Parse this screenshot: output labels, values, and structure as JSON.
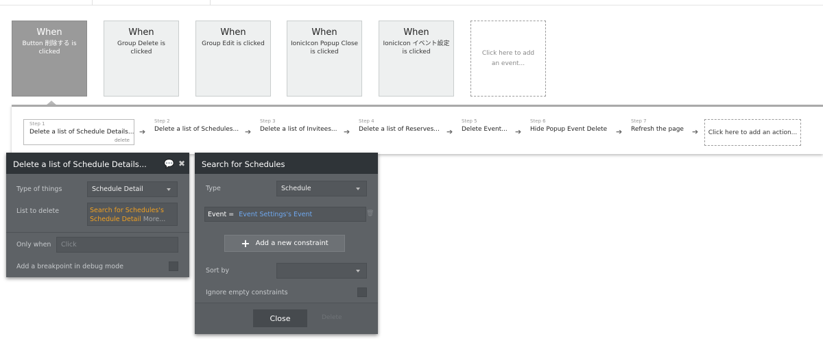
{
  "events": [
    {
      "when": "When",
      "desc": "Button 削除する is clicked"
    },
    {
      "when": "When",
      "desc": "Group Delete is clicked"
    },
    {
      "when": "When",
      "desc": "Group Edit is clicked"
    },
    {
      "when": "When",
      "desc": "IonicIcon Popup Close is clicked"
    },
    {
      "when": "When",
      "desc": "IonicIcon イベント設定 is clicked"
    }
  ],
  "add_event_label": "Click here to add an event...",
  "steps": [
    {
      "num": "Step 1",
      "title": "Delete a list of Schedule Details...",
      "tag": "delete"
    },
    {
      "num": "Step 2",
      "title": "Delete a list of Schedules..."
    },
    {
      "num": "Step 3",
      "title": "Delete a list of Invitees..."
    },
    {
      "num": "Step 4",
      "title": "Delete a list of Reserves..."
    },
    {
      "num": "Step 5",
      "title": "Delete Event..."
    },
    {
      "num": "Step 6",
      "title": "Hide Popup Event Delete"
    },
    {
      "num": "Step 7",
      "title": "Refresh the page"
    }
  ],
  "add_action_label": "Click here to add an action...",
  "action_panel": {
    "title": "Delete a list of Schedule Details...",
    "type_label": "Type of things",
    "type_value": "Schedule Detail",
    "list_label": "List to delete",
    "list_value_line1": "Search for Schedules's",
    "list_value_line2": "Schedule Detail",
    "list_more": "More...",
    "only_when_label": "Only when",
    "only_when_placeholder": "Click",
    "breakpoint_label": "Add a breakpoint in debug mode"
  },
  "search_panel": {
    "title": "Search for Schedules",
    "type_label": "Type",
    "type_value": "Schedule",
    "constraint_key": "Event =",
    "constraint_value": "Event Settings's Event",
    "add_constraint_label": "Add a new constraint",
    "sort_label": "Sort by",
    "sort_value": "",
    "ignore_label": "Ignore empty constraints",
    "close_label": "Close",
    "delete_label": "Delete"
  },
  "colors": {
    "accent_orange": "#f0a022",
    "constraint_blue": "#6fa8ef",
    "panel_bg": "#5e6266",
    "header_bg": "#2f3438"
  }
}
